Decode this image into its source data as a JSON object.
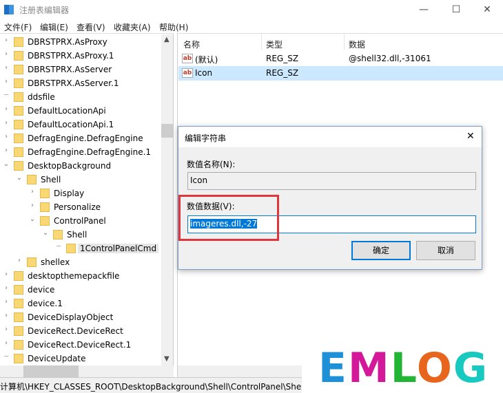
{
  "window": {
    "title": "注册表编辑器",
    "minimize": "—",
    "maximize": "☐",
    "close": "✕"
  },
  "menu": [
    "文件(F)",
    "编辑(E)",
    "查看(V)",
    "收藏夹(A)",
    "帮助(H)"
  ],
  "tree": [
    {
      "label": "DBRSTPRX.AsProxy",
      "level": 0,
      "state": "collapsed"
    },
    {
      "label": "DBRSTPRX.AsProxy.1",
      "level": 0,
      "state": "collapsed"
    },
    {
      "label": "DBRSTPRX.AsServer",
      "level": 0,
      "state": "collapsed"
    },
    {
      "label": "DBRSTPRX.AsServer.1",
      "level": 0,
      "state": "collapsed"
    },
    {
      "label": "ddsfile",
      "level": 0,
      "state": "leaf"
    },
    {
      "label": "DefaultLocationApi",
      "level": 0,
      "state": "collapsed"
    },
    {
      "label": "DefaultLocationApi.1",
      "level": 0,
      "state": "collapsed"
    },
    {
      "label": "DefragEngine.DefragEngine",
      "level": 0,
      "state": "collapsed"
    },
    {
      "label": "DefragEngine.DefragEngine.1",
      "level": 0,
      "state": "collapsed"
    },
    {
      "label": "DesktopBackground",
      "level": 0,
      "state": "expanded"
    },
    {
      "label": "Shell",
      "level": 1,
      "state": "expanded"
    },
    {
      "label": "Display",
      "level": 2,
      "state": "collapsed"
    },
    {
      "label": "Personalize",
      "level": 2,
      "state": "collapsed"
    },
    {
      "label": "ControlPanel",
      "level": 2,
      "state": "expanded"
    },
    {
      "label": "Shell",
      "level": 3,
      "state": "expanded"
    },
    {
      "label": "1ControlPanelCmd",
      "level": 4,
      "state": "leaf",
      "selected": true
    },
    {
      "label": "shellex",
      "level": 1,
      "state": "collapsed"
    },
    {
      "label": "desktopthemepackfile",
      "level": 0,
      "state": "collapsed"
    },
    {
      "label": "device",
      "level": 0,
      "state": "collapsed"
    },
    {
      "label": "device.1",
      "level": 0,
      "state": "collapsed"
    },
    {
      "label": "DeviceDisplayObject",
      "level": 0,
      "state": "collapsed"
    },
    {
      "label": "DeviceRect.DeviceRect",
      "level": 0,
      "state": "collapsed"
    },
    {
      "label": "DeviceRect.DeviceRect.1",
      "level": 0,
      "state": "collapsed"
    },
    {
      "label": "DeviceUpdate",
      "level": 0,
      "state": "leaf"
    }
  ],
  "values": {
    "headers": {
      "name": "名称",
      "type": "类型",
      "data": "数据"
    },
    "rows": [
      {
        "icon": "ab",
        "name": "(默认)",
        "type": "REG_SZ",
        "data": "@shell32.dll,-31061",
        "selected": false
      },
      {
        "icon": "ab",
        "name": "Icon",
        "type": "REG_SZ",
        "data": "",
        "selected": true
      }
    ]
  },
  "status": "计算机\\HKEY_CLASSES_ROOT\\DesktopBackground\\Shell\\ControlPanel\\Shell",
  "dialog": {
    "title": "编辑字符串",
    "close": "✕",
    "name_label": "数值名称(N):",
    "name_value": "Icon",
    "data_label": "数值数据(V):",
    "data_value": "imageres.dll,-27",
    "ok": "确定",
    "cancel": "取消"
  },
  "watermark": {
    "text": "EMLOG",
    "colors": [
      "#1e90d8",
      "#d4189a",
      "#22b535",
      "#e8651e",
      "#18c9c0"
    ]
  },
  "colors": {
    "selection": "#cce8ff",
    "highlight": "#0078d7",
    "annotation": "#e0353b"
  }
}
